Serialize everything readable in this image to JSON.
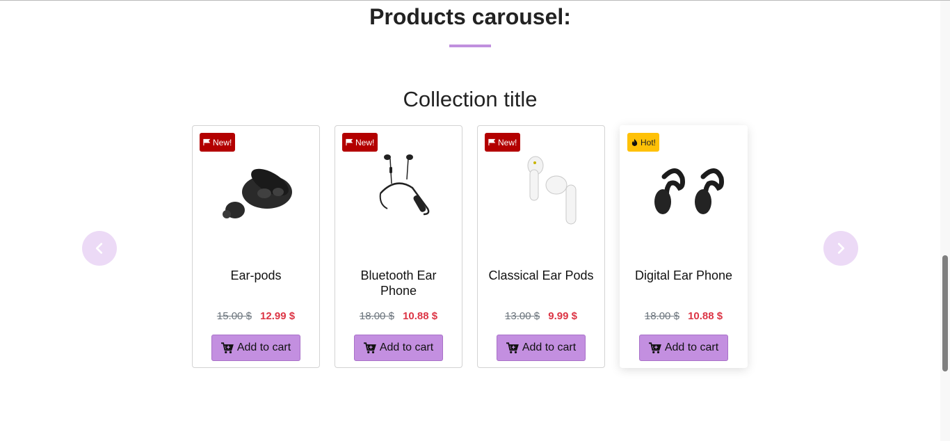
{
  "section": {
    "title": "Products carousel:",
    "accent_color": "#c38fe0"
  },
  "collection": {
    "title": "Collection title"
  },
  "carousel": {
    "prev_icon": "chevron-left-icon",
    "next_icon": "chevron-right-icon"
  },
  "products": [
    {
      "name": "Ear-pods",
      "badge": "New!",
      "badge_icon": "flag-icon",
      "old_price": "15.00 $",
      "new_price": "12.99 $",
      "cart_label": "Add to cart",
      "image": "black-earbuds-with-case"
    },
    {
      "name": "Bluetooth Ear Phone",
      "badge": "New!",
      "badge_icon": "flag-icon",
      "old_price": "18.00 $",
      "new_price": "10.88 $",
      "cart_label": "Add to cart",
      "image": "neckband-earphones"
    },
    {
      "name": "Classical Ear Pods",
      "badge": "New!",
      "badge_icon": "flag-icon",
      "old_price": "13.00 $",
      "new_price": "9.99 $",
      "cart_label": "Add to cart",
      "image": "white-earpods"
    },
    {
      "name": "Digital Ear Phone",
      "badge": "Hot!",
      "badge_icon": "fire-icon",
      "old_price": "18.00 $",
      "new_price": "10.88 $",
      "cart_label": "Add to cart",
      "image": "ear-hook-earphones"
    }
  ],
  "colors": {
    "badge_new": "#b30000",
    "badge_hot": "#ffc107",
    "sale_price": "#dc3545",
    "nav_button": "#ecdaf6"
  }
}
